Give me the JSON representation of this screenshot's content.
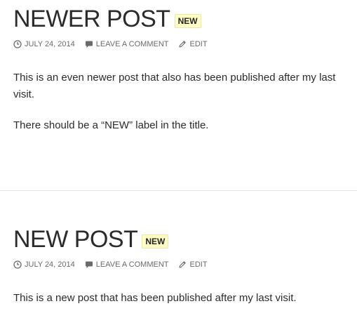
{
  "posts": [
    {
      "title": "NEWER POST",
      "badge": "NEW",
      "meta": {
        "date": "JULY 24, 2014",
        "comment": "LEAVE A COMMENT",
        "edit": "EDIT"
      },
      "paragraphs": [
        "This is an even newer post that also has been published after my last visit.",
        "There should be a “NEW” label in the title."
      ]
    },
    {
      "title": "NEW POST",
      "badge": "NEW",
      "meta": {
        "date": "JULY 24, 2014",
        "comment": "LEAVE A COMMENT",
        "edit": "EDIT"
      },
      "paragraphs": [
        "This is a new post that has been published after my last visit."
      ]
    }
  ],
  "colors": {
    "badge_background": "#ffffc5",
    "text": "#2b2b2b",
    "meta_text": "#6a6a6a",
    "divider": "#e5e5e5"
  },
  "icons": {
    "date": "clock-icon",
    "comment": "speech-bubble-icon",
    "edit": "pencil-icon"
  }
}
